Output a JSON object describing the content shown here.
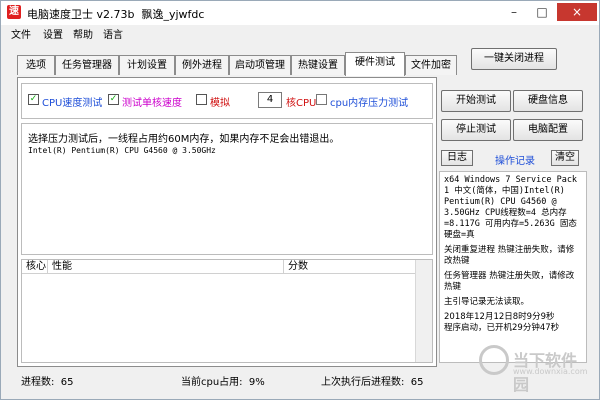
{
  "window": {
    "icon_text": "速",
    "title": "电脑速度卫士 v2.73b",
    "author": "飘逸_yjwfdc",
    "controls": [
      "–",
      "□",
      "×"
    ]
  },
  "menu": [
    "文件",
    "设置",
    "帮助",
    "语言"
  ],
  "tabs": {
    "items": [
      "选项",
      "任务管理器",
      "计划设置",
      "例外进程",
      "启动项管理",
      "热键设置",
      "硬件测试",
      "文件加密"
    ],
    "active": "硬件测试"
  },
  "oneclick_button": "一键关闭进程",
  "options": {
    "cpu_speed_test": "CPU速度测试",
    "single_core_speed": "测试单核速度",
    "simulate": "模拟",
    "core_count": "4",
    "core_unit": "核CPU",
    "cpu_memory_stress": "cpu内存压力测试",
    "colors": {
      "blue": "#1f4fd8",
      "magenta": "#cc00cc",
      "red": "#d01010"
    }
  },
  "console": {
    "line1": "选择压力测试后，一线程占用约60M内存，如果内存不足会出错退出。",
    "line2": "Intel(R) Pentium(R) CPU G4560 @ 3.50GHz"
  },
  "table": {
    "columns": [
      "核心",
      "性能",
      "分数"
    ]
  },
  "buttons": {
    "start_test": "开始测试",
    "disk_info": "硬盘信息",
    "stop_test": "停止测试",
    "pc_config": "电脑配置",
    "log": "日志",
    "clear": "清空"
  },
  "oplog_title": "操作记录",
  "log_entries": [
    "x64 Windows 7 Service Pack 1 中文(简体，中国)Intel(R) Pentium(R) CPU G4560 @ 3.50GHz CPU线程数=4 总内存=8.117G 可用内存=5.263G 固态硬盘=真",
    "关闭重复进程 热键注册失败，请修改热键",
    "任务管理器 热键注册失败，请修改热键",
    "主引导记录无法读取。",
    "2018年12月12日8时9分9秒",
    "程序启动，已开机29分钟47秒"
  ],
  "status": {
    "process_count_label": "进程数:",
    "process_count": "65",
    "cpu_usage_label": "当前cpu占用:",
    "cpu_usage": "9%",
    "after_process_label": "上次执行后进程数:",
    "after_process": "65"
  },
  "watermark": {
    "text": "当下软件园",
    "url": "www.downxia.com"
  }
}
